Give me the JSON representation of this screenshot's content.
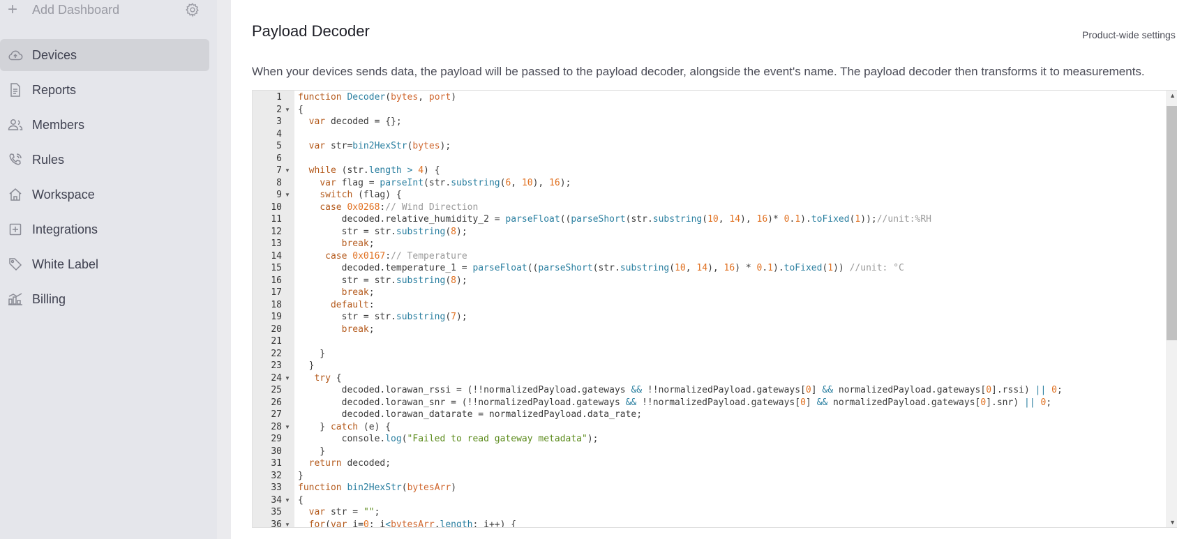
{
  "sidebar": {
    "add_dashboard": "Add Dashboard",
    "items": [
      {
        "label": "Devices",
        "icon": "cloud-icon",
        "active": true
      },
      {
        "label": "Reports",
        "icon": "document-icon",
        "active": false
      },
      {
        "label": "Members",
        "icon": "users-icon",
        "active": false
      },
      {
        "label": "Rules",
        "icon": "phone-icon",
        "active": false
      },
      {
        "label": "Workspace",
        "icon": "house-icon",
        "active": false
      },
      {
        "label": "Integrations",
        "icon": "plus-square-icon",
        "active": false
      },
      {
        "label": "White Label",
        "icon": "tag-icon",
        "active": false
      },
      {
        "label": "Billing",
        "icon": "billing-icon",
        "active": false
      }
    ]
  },
  "main": {
    "title": "Payload Decoder",
    "product_wide_link": "Product-wide settings",
    "description": "When your devices sends data, the payload will be passed to the payload decoder, alongside the event's name. The payload decoder then transforms it to measurements."
  },
  "editor": {
    "line_numbers": [
      "1",
      "2",
      "3",
      "4",
      "5",
      "6",
      "7",
      "8",
      "9",
      "10",
      "11",
      "12",
      "13",
      "14",
      "15",
      "16",
      "17",
      "18",
      "19",
      "20",
      "21",
      "22",
      "23",
      "24",
      "25",
      "26",
      "27",
      "28",
      "29",
      "30",
      "31",
      "32",
      "33",
      "34",
      "35",
      "36"
    ],
    "fold_lines": [
      2,
      7,
      9,
      24,
      28,
      34,
      36
    ],
    "lines": [
      "function Decoder(bytes, port)",
      "{",
      "  var decoded = {};",
      "",
      "  var str=bin2HexStr(bytes);",
      "",
      "  while (str.length > 4) {",
      "    var flag = parseInt(str.substring(6, 10), 16);",
      "    switch (flag) {",
      "    case 0x0268:// Wind Direction",
      "        decoded.relative_humidity_2 = parseFloat((parseShort(str.substring(10, 14), 16)* 0.1).toFixed(1));//unit:%RH",
      "        str = str.substring(8);",
      "        break;",
      "     case 0x0167:// Temperature",
      "        decoded.temperature_1 = parseFloat((parseShort(str.substring(10, 14), 16) * 0.1).toFixed(1)) //unit: °C",
      "        str = str.substring(8);",
      "        break;",
      "      default:",
      "        str = str.substring(7);",
      "        break;",
      "",
      "    }",
      "  }",
      "   try {",
      "        decoded.lorawan_rssi = (!!normalizedPayload.gateways && !!normalizedPayload.gateways[0] && normalizedPayload.gateways[0].rssi) || 0;",
      "        decoded.lorawan_snr = (!!normalizedPayload.gateways && !!normalizedPayload.gateways[0] && normalizedPayload.gateways[0].snr) || 0;",
      "        decoded.lorawan_datarate = normalizedPayload.data_rate;",
      "    } catch (e) {",
      "        console.log(\"Failed to read gateway metadata\");",
      "    }",
      "  return decoded;",
      "}",
      "function bin2HexStr(bytesArr)",
      "{",
      "  var str = \"\";",
      "  for(var i=0; i<bytesArr.length; i++) {"
    ]
  }
}
